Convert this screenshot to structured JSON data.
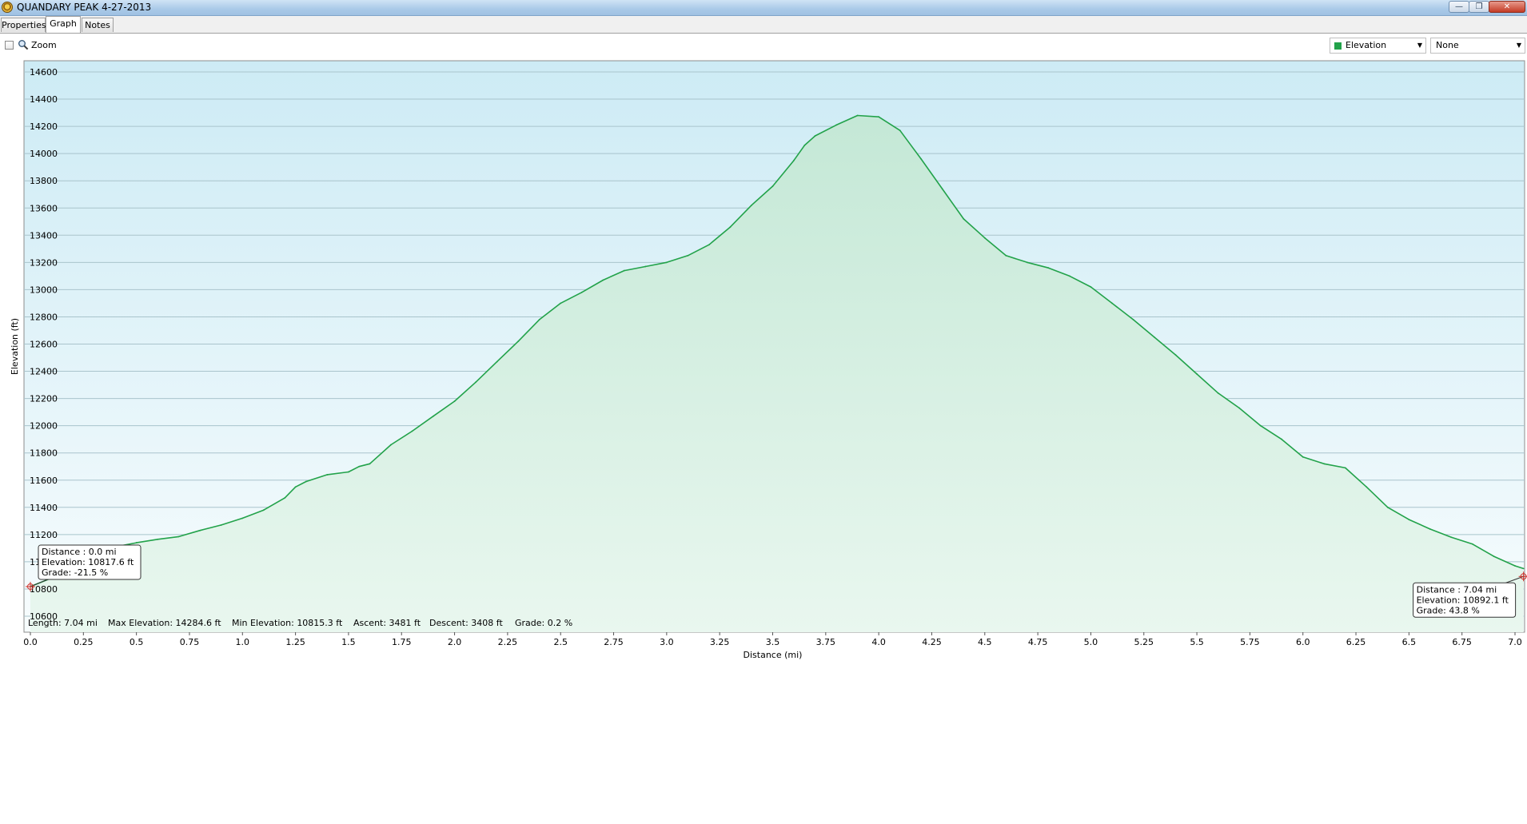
{
  "window": {
    "title": "QUANDARY PEAK 4-27-2013",
    "minimize_glyph": "—",
    "maximize_glyph": "❐",
    "close_glyph": "✕"
  },
  "tabs": [
    {
      "label": "Properties",
      "active": false
    },
    {
      "label": "Graph",
      "active": true
    },
    {
      "label": "Notes",
      "active": false
    }
  ],
  "toolbar": {
    "zoom_checked": false,
    "zoom_icon": "magnifier-icon",
    "zoom_label": "Zoom",
    "primary_series": "Elevation",
    "primary_series_color": "#22a24a",
    "secondary_series": "None"
  },
  "stats": {
    "length": "Length: 7.04 mi",
    "max_elevation": "Max Elevation: 14284.6 ft",
    "min_elevation": "Min Elevation: 10815.3 ft",
    "ascent": "Ascent: 3481 ft",
    "descent": "Descent: 3408 ft",
    "grade": "Grade: 0.2 %"
  },
  "tooltips": [
    {
      "at_x": 0.0,
      "at_y": 10817.6,
      "anchor": "left",
      "lines": [
        "Distance  : 0.0 mi",
        "Elevation: 10817.6 ft",
        "Grade: -21.5 %"
      ]
    },
    {
      "at_x": 7.04,
      "at_y": 10892.1,
      "anchor": "right",
      "lines": [
        "Distance  : 7.04 mi",
        "Elevation: 10892.1 ft",
        "Grade: 43.8 %"
      ]
    }
  ],
  "chart_data": {
    "type": "area",
    "xlabel": "Distance  (mi)",
    "ylabel": "Elevation (ft)",
    "xlim": [
      0.0,
      7.0
    ],
    "ylim": [
      10500,
      14750
    ],
    "x_ticks": [
      "0.0",
      "0.25",
      "0.5",
      "0.75",
      "1.0",
      "1.25",
      "1.5",
      "1.75",
      "2.0",
      "2.25",
      "2.5",
      "2.75",
      "3.0",
      "3.25",
      "3.5",
      "3.75",
      "4.0",
      "4.25",
      "4.5",
      "4.75",
      "5.0",
      "5.25",
      "5.5",
      "5.75",
      "6.0",
      "6.25",
      "6.5",
      "6.75",
      "7.0"
    ],
    "y_ticks": [
      "10600",
      "10800",
      "11000",
      "11200",
      "11400",
      "11600",
      "11800",
      "12000",
      "12200",
      "12400",
      "12600",
      "12800",
      "13000",
      "13200",
      "13400",
      "13600",
      "13800",
      "14000",
      "14200",
      "14400",
      "14600"
    ],
    "grid": true,
    "line_color": "#22a24a",
    "series": [
      {
        "name": "Elevation",
        "x": [
          0.0,
          0.1,
          0.2,
          0.3,
          0.4,
          0.5,
          0.6,
          0.7,
          0.8,
          0.9,
          1.0,
          1.1,
          1.2,
          1.25,
          1.3,
          1.4,
          1.5,
          1.55,
          1.6,
          1.7,
          1.8,
          1.9,
          2.0,
          2.1,
          2.2,
          2.3,
          2.4,
          2.5,
          2.6,
          2.7,
          2.8,
          2.9,
          3.0,
          3.1,
          3.2,
          3.3,
          3.4,
          3.5,
          3.6,
          3.65,
          3.7,
          3.8,
          3.9,
          4.0,
          4.1,
          4.2,
          4.3,
          4.4,
          4.5,
          4.6,
          4.7,
          4.8,
          4.9,
          5.0,
          5.1,
          5.2,
          5.3,
          5.4,
          5.5,
          5.6,
          5.7,
          5.8,
          5.9,
          6.0,
          6.1,
          6.2,
          6.3,
          6.4,
          6.5,
          6.6,
          6.7,
          6.8,
          6.9,
          7.0,
          7.04
        ],
        "y": [
          10818,
          10880,
          10960,
          11050,
          11110,
          11140,
          11165,
          11185,
          11230,
          11270,
          11320,
          11380,
          11470,
          11550,
          11590,
          11640,
          11660,
          11700,
          11720,
          11860,
          11960,
          12070,
          12180,
          12320,
          12470,
          12620,
          12780,
          12900,
          12980,
          13070,
          13140,
          13170,
          13200,
          13250,
          13330,
          13460,
          13620,
          13760,
          13950,
          14060,
          14130,
          14210,
          14280,
          14270,
          14170,
          13960,
          13740,
          13520,
          13380,
          13250,
          13200,
          13160,
          13100,
          13020,
          12900,
          12780,
          12650,
          12520,
          12380,
          12240,
          12130,
          12000,
          11900,
          11770,
          11720,
          11690,
          11550,
          11400,
          11310,
          11240,
          11180,
          11130,
          11040,
          10970,
          10950
        ]
      }
    ]
  }
}
